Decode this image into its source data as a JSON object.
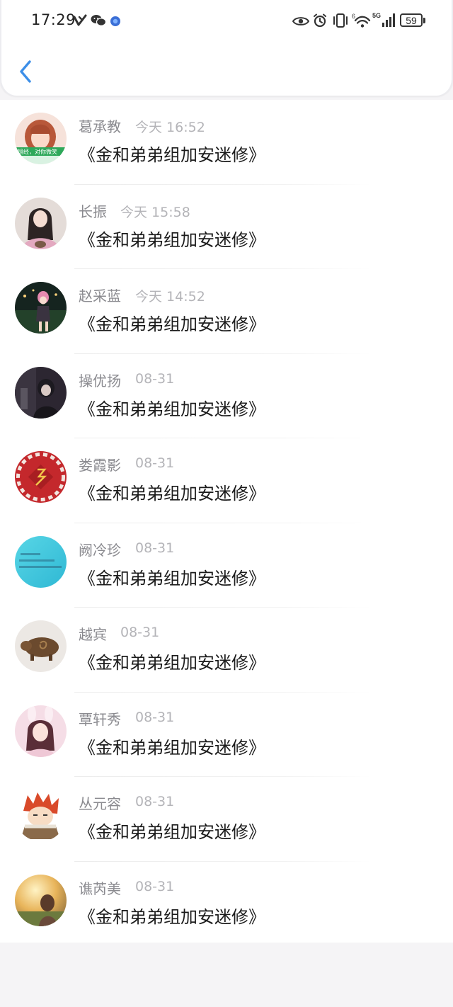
{
  "status_bar": {
    "time": "17:29",
    "left_icons": [
      "vivo-heart-icon",
      "wechat-icon",
      "app-badge-icon"
    ],
    "right_icons": [
      "eye-icon",
      "alarm-icon",
      "vibrate-icon",
      "wifi-icon",
      "signal-5g-icon"
    ],
    "wifi_label": "6",
    "network_label": "5G",
    "battery_level": "59"
  },
  "nav": {
    "back_icon": "chevron-left-icon"
  },
  "items": [
    {
      "name": "葛承教",
      "time": "今天 16:52",
      "title": "《金和弟弟组加安迷修》",
      "avatar": "girl-photo-avatar"
    },
    {
      "name": "长振",
      "time": "今天 15:58",
      "title": "《金和弟弟组加安迷修》",
      "avatar": "girl-pink-sweater-avatar"
    },
    {
      "name": "赵采蓝",
      "time": "今天 14:52",
      "title": "《金和弟弟组加安迷修》",
      "avatar": "anime-night-avatar"
    },
    {
      "name": "操优扬",
      "time": "08-31",
      "title": "《金和弟弟组加安迷修》",
      "avatar": "anime-dark-avatar"
    },
    {
      "name": "娄霞影",
      "time": "08-31",
      "title": "《金和弟弟组加安迷修》",
      "avatar": "red-ornament-avatar"
    },
    {
      "name": "阙冷珍",
      "time": "08-31",
      "title": "《金和弟弟组加安迷修》",
      "avatar": "cyan-text-avatar"
    },
    {
      "name": "越宾",
      "time": "08-31",
      "title": "《金和弟弟组加安迷修》",
      "avatar": "bronze-pig-avatar"
    },
    {
      "name": "覃轩秀",
      "time": "08-31",
      "title": "《金和弟弟组加安迷修》",
      "avatar": "bunny-girl-avatar"
    },
    {
      "name": "丛元容",
      "time": "08-31",
      "title": "《金和弟弟组加安迷修》",
      "avatar": "cartoon-boy-avatar"
    },
    {
      "name": "谯芮美",
      "time": "08-31",
      "title": "《金和弟弟组加安迷修》",
      "avatar": "sunset-girl-avatar"
    }
  ],
  "colors": {
    "accent": "#3d8fe8",
    "name_text": "#8a8a8f",
    "time_text": "#b4b4b8",
    "title_text": "#1b1b1b",
    "background": "#f5f4f6"
  }
}
